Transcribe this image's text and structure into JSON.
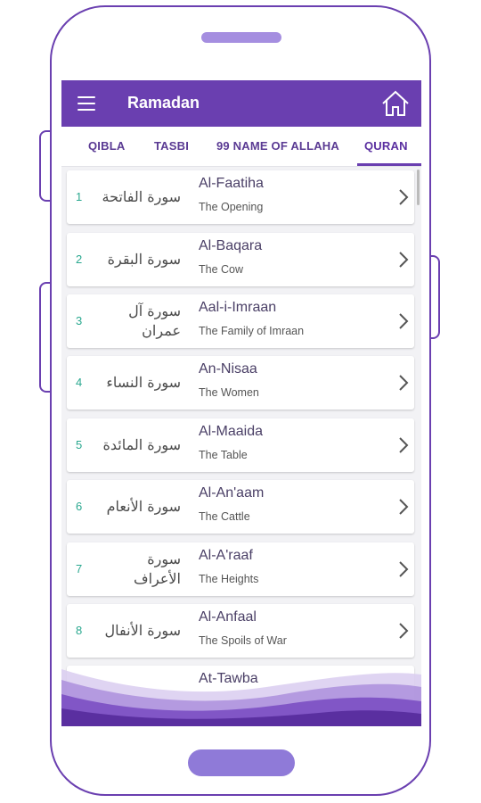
{
  "app": {
    "title": "Ramadan"
  },
  "icons": {
    "menu": "hamburger-menu-icon",
    "home": "home-icon",
    "chevron": "chevron-right-icon"
  },
  "tabs": [
    {
      "label": "QIBLA"
    },
    {
      "label": "TASBI"
    },
    {
      "label": "99 NAME OF ALLAHA"
    },
    {
      "label": "QURAN",
      "selected": true
    }
  ],
  "surahs": [
    {
      "number": "1",
      "arabic": "سورة الفاتحة",
      "name": "Al-Faatiha",
      "meaning": "The Opening"
    },
    {
      "number": "2",
      "arabic": "سورة البقرة",
      "name": "Al-Baqara",
      "meaning": "The Cow"
    },
    {
      "number": "3",
      "arabic_line1": "سورة آل",
      "arabic_line2": "عمران",
      "name": "Aal-i-Imraan",
      "meaning": "The Family of Imraan"
    },
    {
      "number": "4",
      "arabic": "سورة النساء",
      "name": "An-Nisaa",
      "meaning": "The Women"
    },
    {
      "number": "5",
      "arabic": "سورة المائدة",
      "name": "Al-Maaida",
      "meaning": "The Table"
    },
    {
      "number": "6",
      "arabic": "سورة الأنعام",
      "name": "Al-An'aam",
      "meaning": "The Cattle"
    },
    {
      "number": "7",
      "arabic_line1": "سورة",
      "arabic_line2": "الأعراف",
      "name": "Al-A'raaf",
      "meaning": "The Heights"
    },
    {
      "number": "8",
      "arabic": "سورة الأنفال",
      "name": "Al-Anfaal",
      "meaning": "The Spoils of War"
    },
    {
      "name": "At-Tawba"
    }
  ],
  "colors": {
    "primary": "#6a3fb0",
    "number": "#2aa88f"
  }
}
